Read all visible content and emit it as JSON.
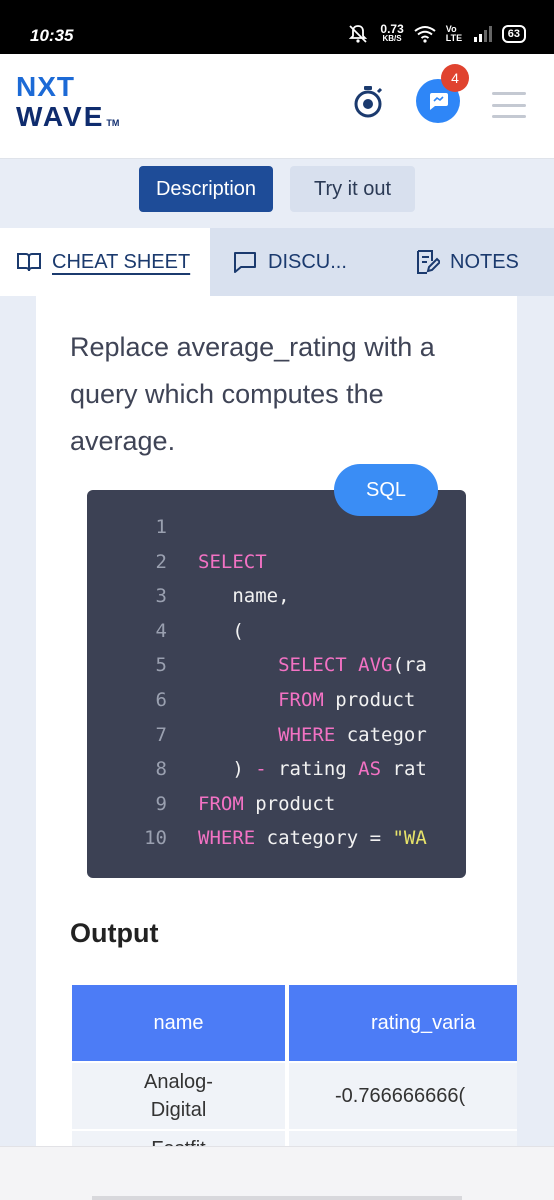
{
  "status_bar": {
    "time": "10:35",
    "net_speed": "0.73",
    "net_unit": "KB/S",
    "volte": "Vo LTE",
    "battery": "63"
  },
  "header": {
    "logo_line1": "NXT",
    "logo_line2": "WAVE",
    "logo_tm": "TM",
    "chat_badge_count": "4"
  },
  "toggle": {
    "description_label": "Description",
    "try_label": "Try it out"
  },
  "tabs": [
    {
      "label": "CHEAT SHEET",
      "icon": "book-icon",
      "active": true
    },
    {
      "label": "DISCU...",
      "icon": "chat-bubble-icon",
      "active": false
    },
    {
      "label": "NOTES",
      "icon": "notes-edit-icon",
      "active": false
    }
  ],
  "content": {
    "paragraph": "Replace average_rating with a query which computes the average.",
    "code_language": "SQL",
    "code_lines": [
      {
        "n": "1",
        "parts": []
      },
      {
        "n": "2",
        "parts": [
          {
            "t": "SELECT",
            "c": "kw"
          }
        ]
      },
      {
        "n": "3",
        "parts": [
          {
            "t": "   name,",
            "c": ""
          }
        ]
      },
      {
        "n": "4",
        "parts": [
          {
            "t": "   (",
            "c": ""
          }
        ]
      },
      {
        "n": "5",
        "parts": [
          {
            "t": "       ",
            "c": ""
          },
          {
            "t": "SELECT",
            "c": "kw"
          },
          {
            "t": " ",
            "c": ""
          },
          {
            "t": "AVG",
            "c": "fn"
          },
          {
            "t": "(ra",
            "c": ""
          }
        ]
      },
      {
        "n": "6",
        "parts": [
          {
            "t": "       ",
            "c": ""
          },
          {
            "t": "FROM",
            "c": "kw"
          },
          {
            "t": " product",
            "c": ""
          }
        ]
      },
      {
        "n": "7",
        "parts": [
          {
            "t": "       ",
            "c": ""
          },
          {
            "t": "WHERE",
            "c": "kw"
          },
          {
            "t": " categor",
            "c": ""
          }
        ]
      },
      {
        "n": "8",
        "parts": [
          {
            "t": "   ) ",
            "c": ""
          },
          {
            "t": "-",
            "c": "kw"
          },
          {
            "t": " rating ",
            "c": ""
          },
          {
            "t": "AS",
            "c": "kw"
          },
          {
            "t": " rat",
            "c": ""
          }
        ]
      },
      {
        "n": "9",
        "parts": [
          {
            "t": "FROM",
            "c": "kw"
          },
          {
            "t": " product",
            "c": ""
          }
        ]
      },
      {
        "n": "10",
        "parts": [
          {
            "t": "WHERE",
            "c": "kw"
          },
          {
            "t": " category = ",
            "c": ""
          },
          {
            "t": "\"WA",
            "c": "str"
          }
        ]
      }
    ],
    "output_title": "Output",
    "table": {
      "headers": [
        "name",
        "rating_varia"
      ],
      "rows": [
        [
          "Analog-Digital",
          "-0.766666666("
        ],
        [
          "Fastfit",
          ""
        ]
      ]
    }
  },
  "colors": {
    "primary_blue": "#1e4c98",
    "accent_blue": "#3a8df5",
    "table_header": "#4c7cf6",
    "code_bg": "#3c4154",
    "keyword_pink": "#f372c4",
    "string_yellow": "#e7e36a",
    "badge_red": "#e0432f"
  }
}
